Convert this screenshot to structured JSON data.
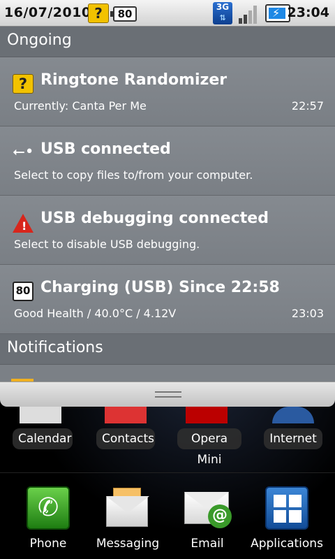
{
  "status_bar": {
    "date": "16/07/2010",
    "time": "23:04",
    "battery_level": "80",
    "network_type": "3G",
    "signal_bars": 2,
    "icons": [
      "question-icon",
      "battery-icon",
      "3g-data-icon",
      "signal-icon",
      "charging-icon"
    ]
  },
  "panel": {
    "ongoing_header": "Ongoing",
    "notifications_header": "Notifications",
    "ongoing": [
      {
        "icon": "question-icon",
        "title": "Ringtone Randomizer",
        "description": "Currently: Canta Per Me",
        "time": "22:57"
      },
      {
        "icon": "usb-icon",
        "title": "USB connected",
        "description": "Select to copy files to/from your computer.",
        "time": ""
      },
      {
        "icon": "warning-icon",
        "title": "USB debugging connected",
        "description": "Select to disable USB debugging.",
        "time": ""
      },
      {
        "icon": "battery-icon",
        "icon_text": "80",
        "title": "Charging (USB) Since 22:58",
        "description": "Good Health / 40.0°C / 4.12V",
        "time": "23:03"
      }
    ]
  },
  "home": {
    "workspace_apps": [
      "Calendar",
      "Contacts",
      "Opera Mini",
      "Internet"
    ],
    "dock": [
      "Phone",
      "Messaging",
      "Email",
      "Applications"
    ]
  },
  "colors": {
    "panel_bg": "#7b8086",
    "accent_blue": "#1e88e5",
    "warning_red": "#d7261c",
    "question_yellow": "#f2c200"
  }
}
